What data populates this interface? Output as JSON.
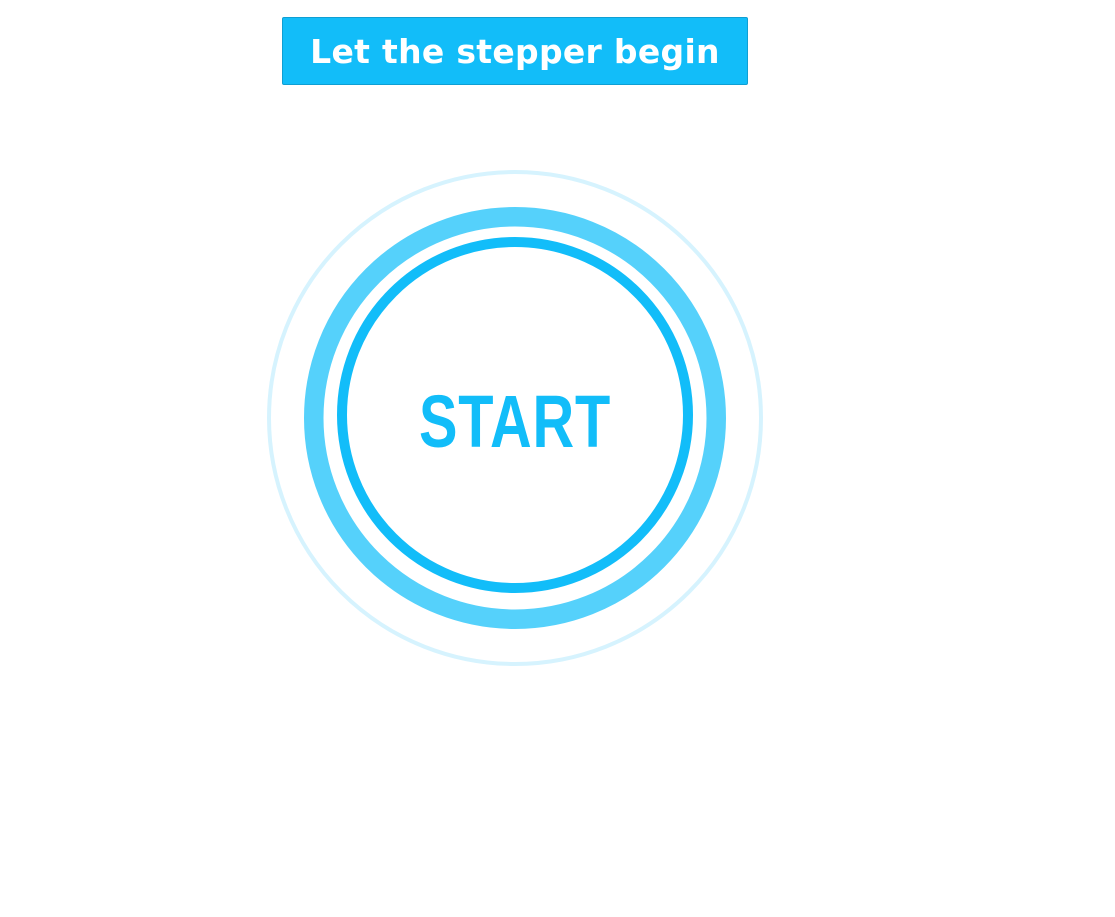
{
  "header": {
    "begin_button_label": "Let the stepper begin"
  },
  "start_control": {
    "label": "START"
  },
  "colors": {
    "accent": "#12bdf9",
    "ring_mid": "#55d1fb",
    "ring_outer": "#d6f3fe",
    "background": "#ffffff"
  }
}
